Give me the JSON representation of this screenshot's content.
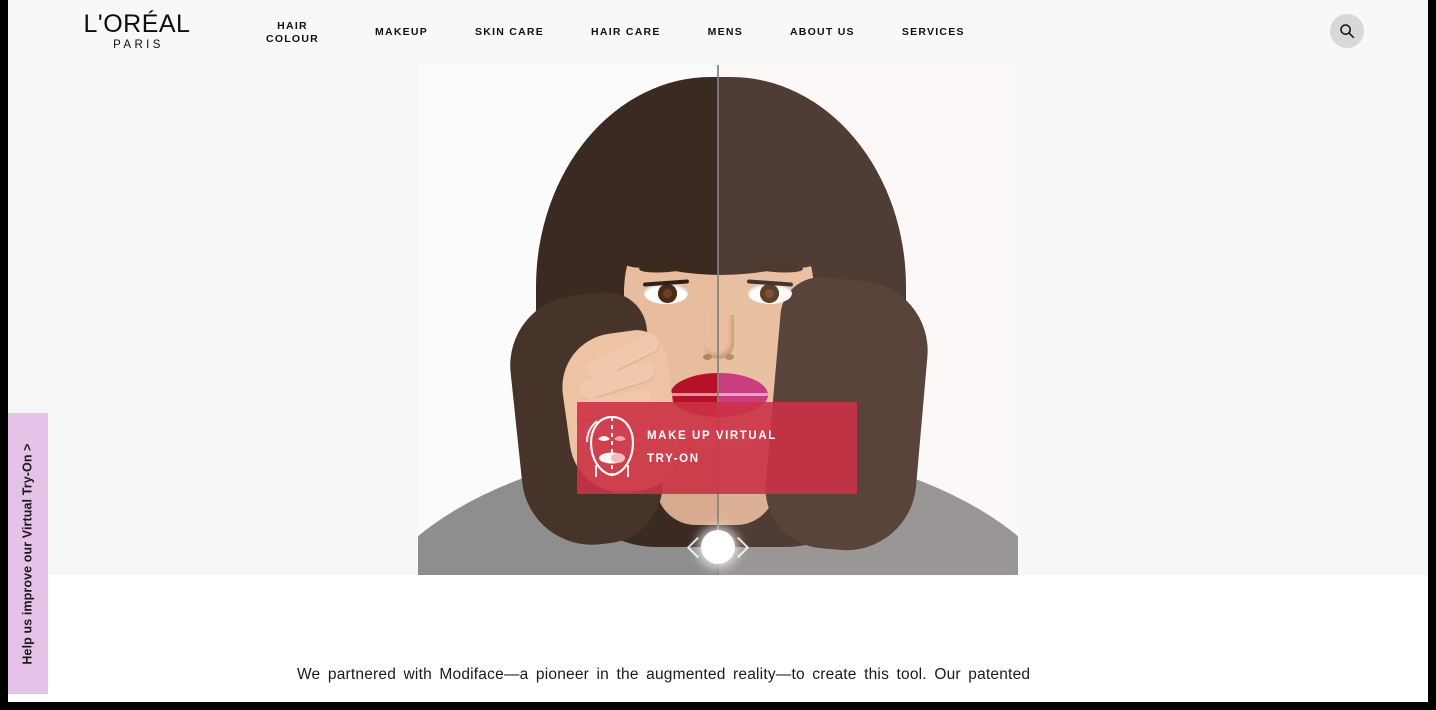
{
  "header": {
    "logo": {
      "main": "L'ORÉAL",
      "sub": "PARIS"
    },
    "nav": [
      {
        "label": "HAIR\nCOLOUR"
      },
      {
        "label": "MAKEUP"
      },
      {
        "label": "SKIN CARE"
      },
      {
        "label": "HAIR CARE"
      },
      {
        "label": "MENS"
      },
      {
        "label": "ABOUT US"
      },
      {
        "label": "SERVICES"
      }
    ],
    "search": {
      "icon": "search-icon"
    }
  },
  "hero": {
    "banner": {
      "label": "MAKE UP VIRTUAL\nTRY-ON",
      "icon": "split-face-icon",
      "color": "#CB3246"
    },
    "slider": {
      "icon_left": "chevron-left-icon",
      "icon_right": "chevron-right-icon"
    }
  },
  "feedback_tab": {
    "label": "Help us improve our Virtual Try-On  >",
    "color": "#E5C3E8"
  },
  "main": {
    "paragraph": "We partnered with Modiface—a pioneer in the augmented reality—to create this tool. Our patented"
  }
}
